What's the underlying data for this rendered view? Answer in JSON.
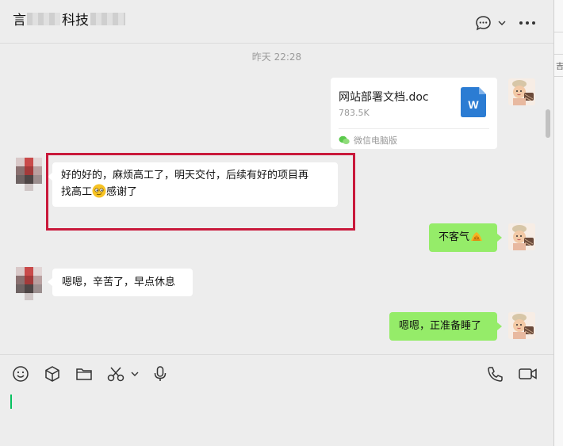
{
  "header": {
    "title_prefix": "言",
    "title_middle": "科技",
    "chat_menu_icon": "chat-bubble-icon",
    "more_icon": "more-dots-icon"
  },
  "right_window": {
    "char": "吉"
  },
  "timestamp": "昨天 22:28",
  "messages": {
    "file": {
      "name": "网站部署文档.doc",
      "size": "783.5K",
      "source": "微信电脑版",
      "icon_letter": "W",
      "icon_color": "#2b7cd3"
    },
    "other_1": {
      "line1": "好的好的，麻烦高工了，明天交付，后续有好的项目再",
      "line2_a": "找高工",
      "line2_b": "感谢了"
    },
    "mine_1": {
      "text": "不客气"
    },
    "other_2": {
      "text": "嗯嗯，辛苦了，早点休息"
    },
    "mine_2": {
      "text": "嗯嗯，正准备睡了"
    }
  },
  "toolbar": {
    "left": [
      "emoji-icon",
      "box-icon",
      "folder-icon",
      "scissors-icon",
      "chevron-down-icon",
      "microphone-icon"
    ],
    "right": [
      "phone-icon",
      "video-icon"
    ]
  },
  "colors": {
    "accent_green": "#95ec69",
    "highlight_red": "#c9193b",
    "cursor_green": "#07c160"
  }
}
